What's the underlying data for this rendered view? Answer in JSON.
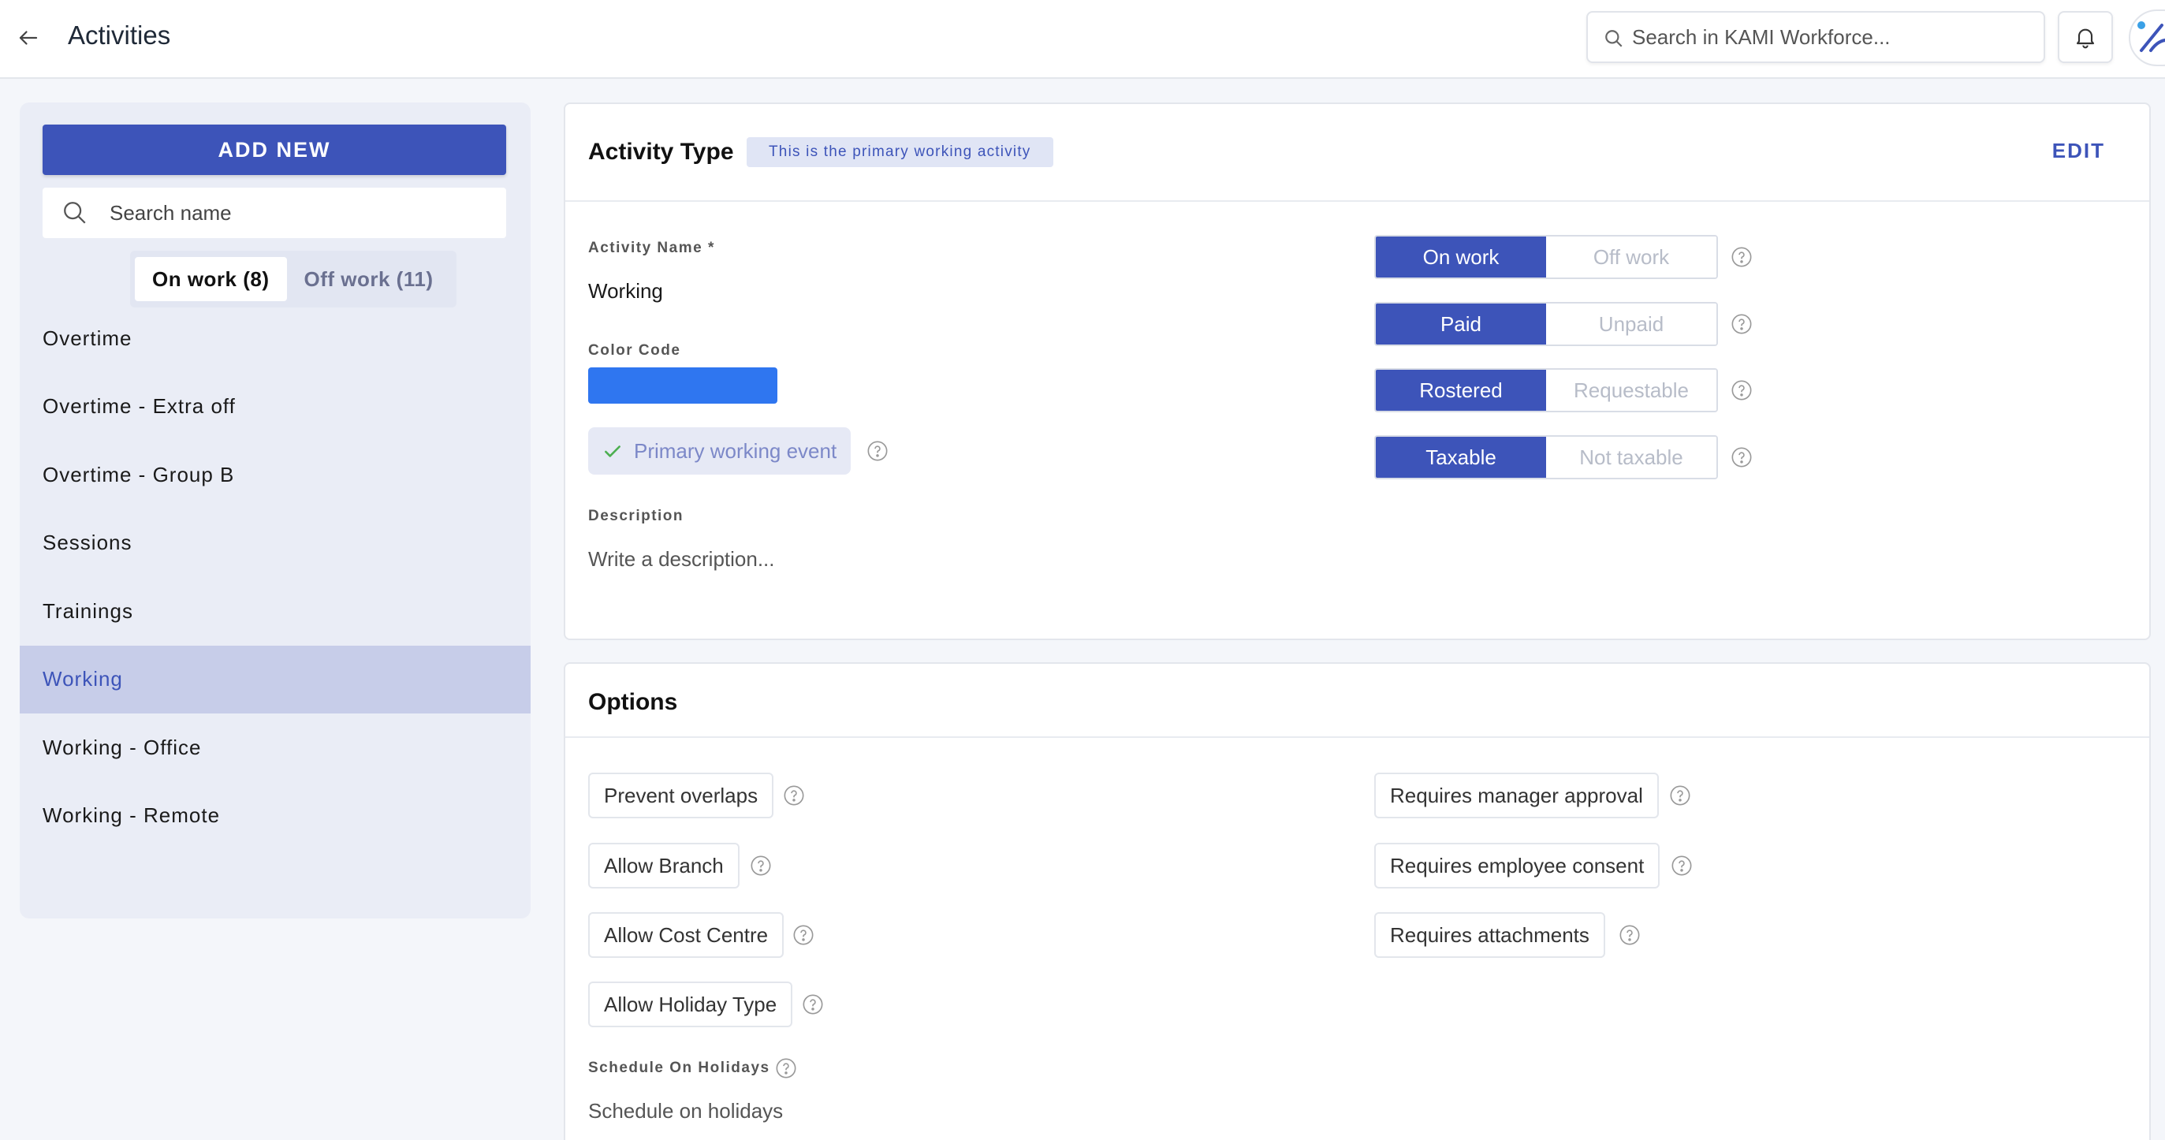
{
  "header": {
    "title": "Activities",
    "search_placeholder": "Search in KAMI Workforce..."
  },
  "sidebar": {
    "add_new_label": "ADD NEW",
    "search_placeholder": "Search name",
    "tabs": [
      {
        "label": "On work (8)",
        "active": true
      },
      {
        "label": "Off work (11)",
        "active": false
      }
    ],
    "items": [
      {
        "label": "Overtime"
      },
      {
        "label": "Overtime - Extra off"
      },
      {
        "label": "Overtime - Group B"
      },
      {
        "label": "Sessions"
      },
      {
        "label": "Trainings"
      },
      {
        "label": "Working",
        "selected": true
      },
      {
        "label": "Working - Office"
      },
      {
        "label": "Working - Remote"
      }
    ]
  },
  "activity_type": {
    "title": "Activity Type",
    "badge": "This is the primary working activity",
    "edit_label": "EDIT",
    "name_label": "Activity Name *",
    "name_value": "Working",
    "color_label": "Color Code",
    "color_value": "#2f76f0",
    "primary_event_label": "Primary working event",
    "description_label": "Description",
    "description_placeholder": "Write a description...",
    "toggles": [
      {
        "on": "On work",
        "off": "Off work"
      },
      {
        "on": "Paid",
        "off": "Unpaid"
      },
      {
        "on": "Rostered",
        "off": "Requestable"
      },
      {
        "on": "Taxable",
        "off": "Not taxable"
      }
    ]
  },
  "options": {
    "title": "Options",
    "left": [
      "Prevent overlaps",
      "Allow Branch",
      "Allow Cost Centre",
      "Allow Holiday Type"
    ],
    "right": [
      "Requires manager approval",
      "Requires employee consent",
      "Requires attachments"
    ],
    "schedule_label": "Schedule On Holidays",
    "schedule_value": "Schedule on holidays"
  },
  "colors": {
    "accent": "#3d54b9",
    "sidebar_bg": "#eaedf6",
    "selected_bg": "#c7cde9"
  }
}
